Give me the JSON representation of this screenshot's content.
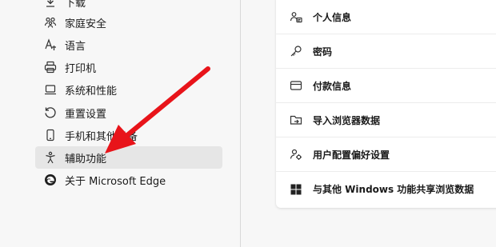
{
  "sidebar": {
    "items": [
      {
        "label": "下载",
        "icon": "download-icon"
      },
      {
        "label": "家庭安全",
        "icon": "family-icon"
      },
      {
        "label": "语言",
        "icon": "language-icon"
      },
      {
        "label": "打印机",
        "icon": "printer-icon"
      },
      {
        "label": "系统和性能",
        "icon": "laptop-icon"
      },
      {
        "label": "重置设置",
        "icon": "reset-icon"
      },
      {
        "label": "手机和其他设备",
        "icon": "phone-icon"
      },
      {
        "label": "辅助功能",
        "icon": "accessibility-icon",
        "selected": true
      },
      {
        "label": "关于 Microsoft Edge",
        "icon": "edge-icon"
      }
    ]
  },
  "main": {
    "rows": [
      {
        "label": "个人信息",
        "icon": "person-card-icon"
      },
      {
        "label": "密码",
        "icon": "key-icon"
      },
      {
        "label": "付款信息",
        "icon": "card-icon"
      },
      {
        "label": "导入浏览器数据",
        "icon": "import-icon"
      },
      {
        "label": "用户配置偏好设置",
        "icon": "profile-settings-icon"
      },
      {
        "label": "与其他 Windows 功能共享浏览数据",
        "icon": "windows-icon"
      }
    ]
  },
  "annotation": {
    "color": "#e8141a"
  }
}
